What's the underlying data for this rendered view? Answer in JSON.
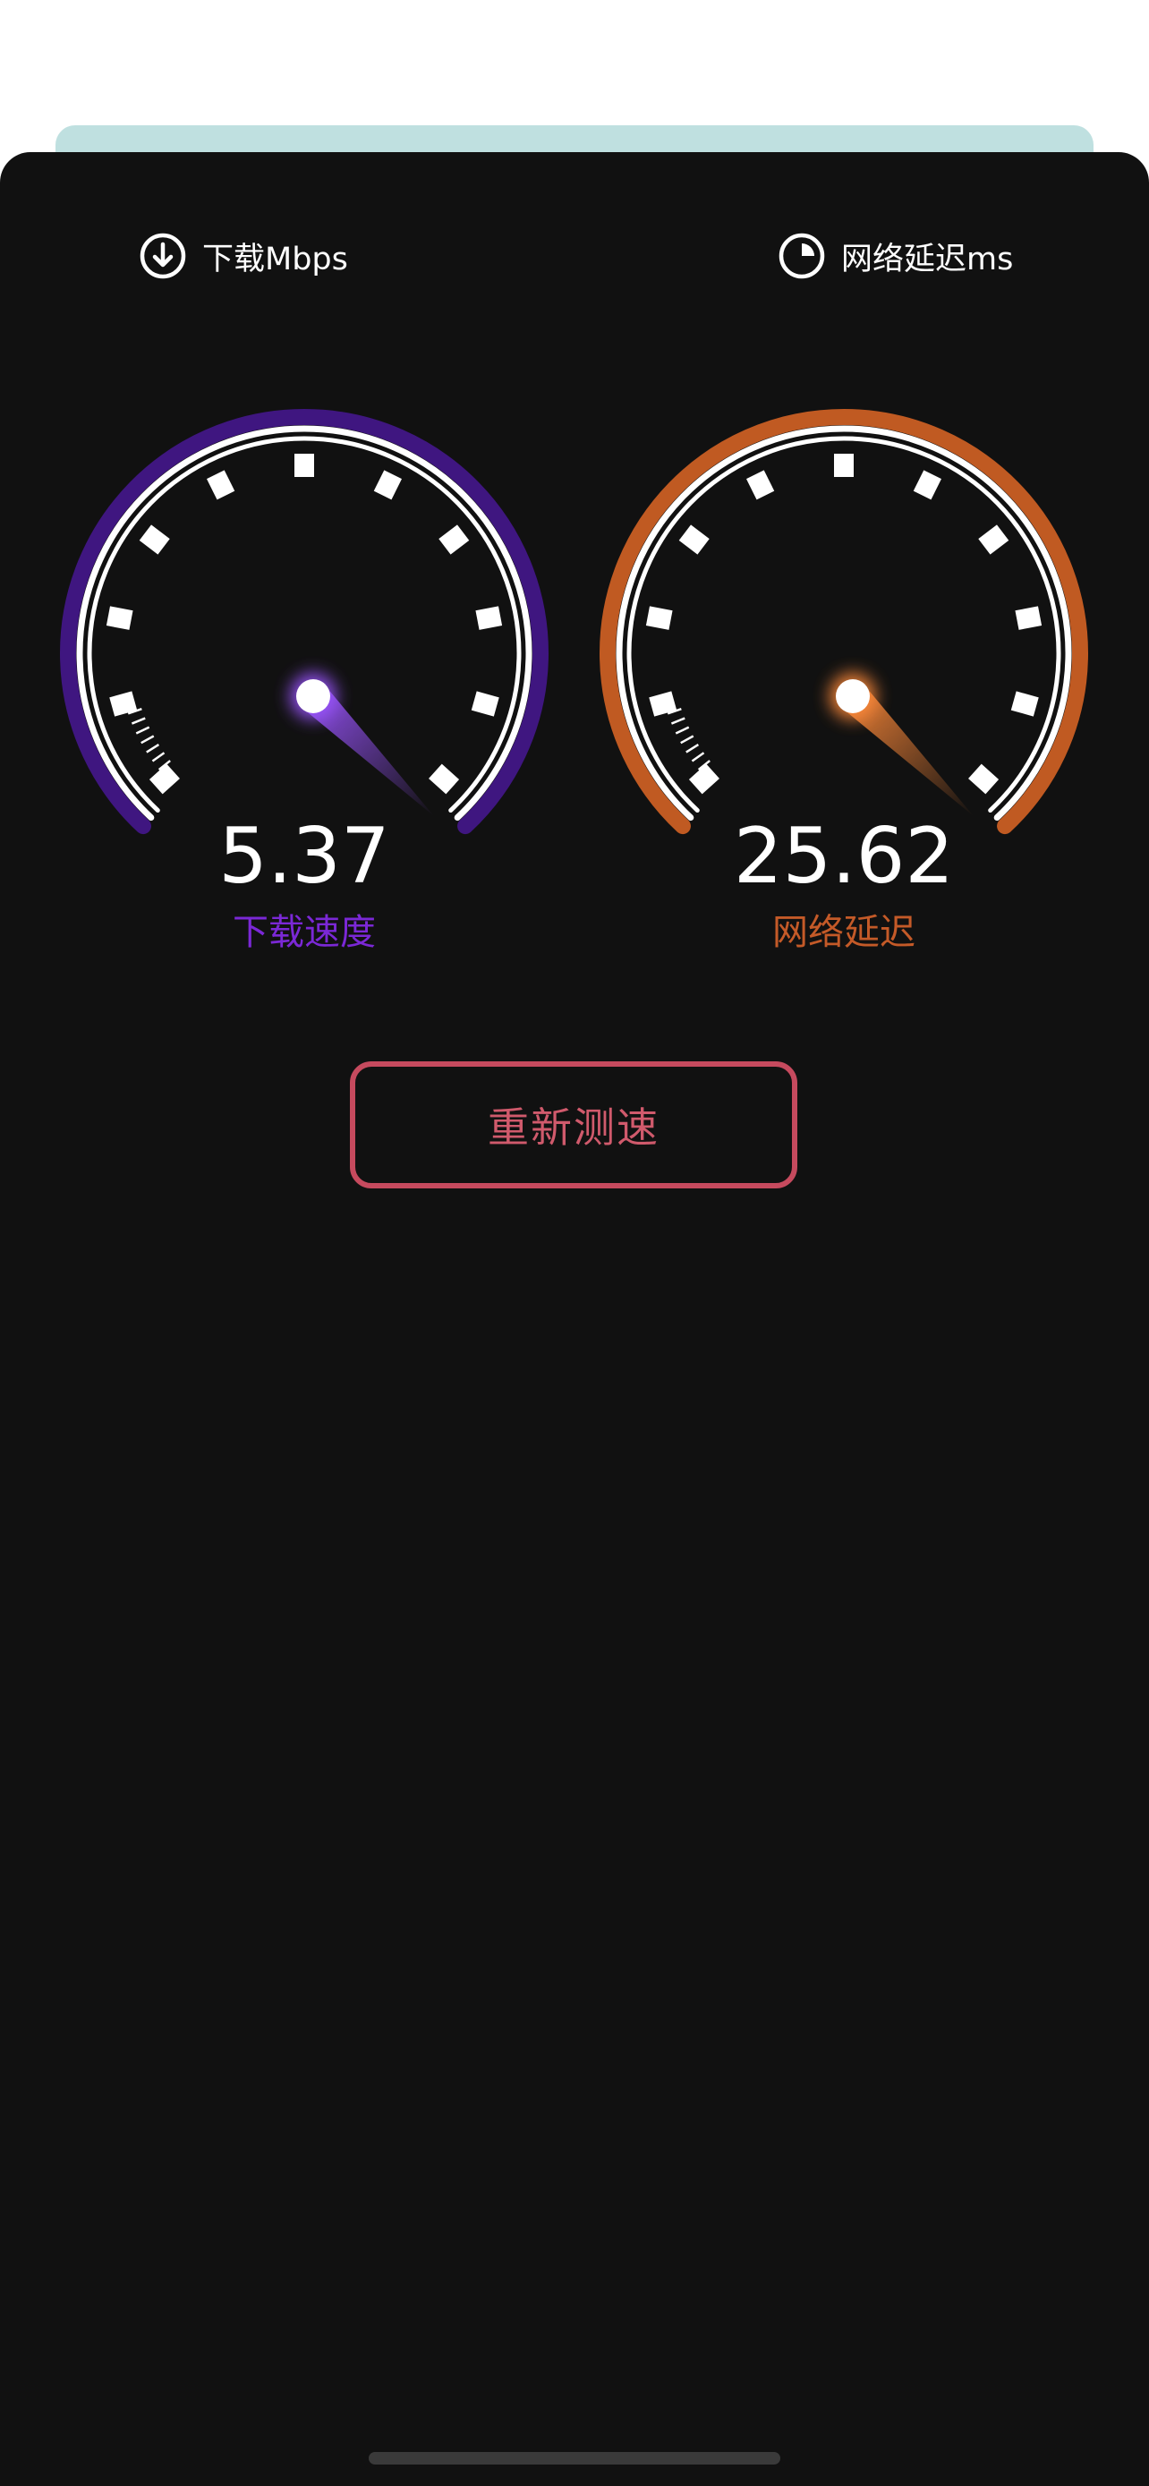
{
  "header": {
    "download_label": "下载Mbps",
    "latency_label": "网络延迟ms"
  },
  "gauges": {
    "download": {
      "value": "5.37",
      "label": "下载速度",
      "color": "#3f1680",
      "glow": "#9b55ff"
    },
    "latency": {
      "value": "25.62",
      "label": "网络延迟",
      "color": "#c05a22",
      "glow": "#ff8a3a"
    }
  },
  "actions": {
    "retest_label": "重新测速",
    "retest_color": "#c64a5e"
  },
  "icons": {
    "download": "download-circle-icon",
    "latency": "clock-icon"
  }
}
